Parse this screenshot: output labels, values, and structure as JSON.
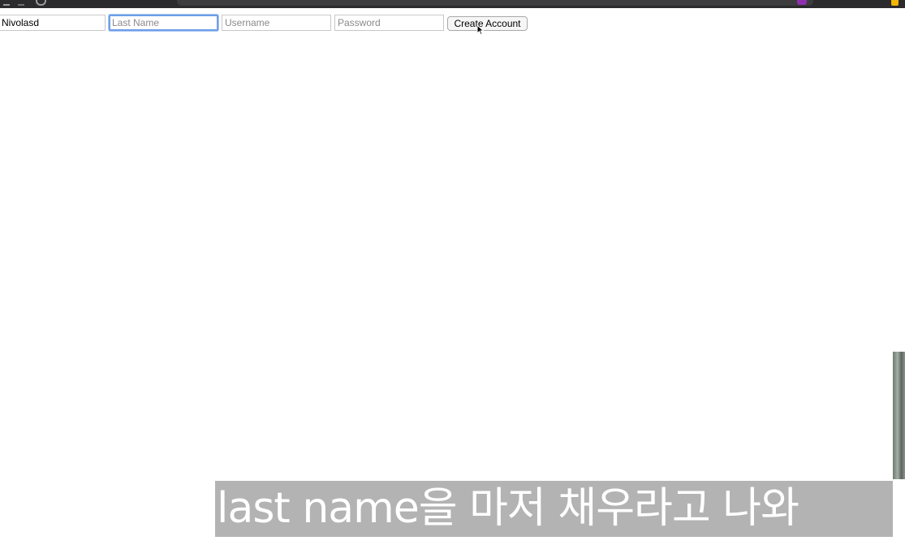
{
  "form": {
    "first_name": {
      "value": "Nivolasd",
      "placeholder": ""
    },
    "last_name": {
      "value": "",
      "placeholder": "Last Name"
    },
    "username": {
      "value": "",
      "placeholder": "Username"
    },
    "password": {
      "value": "",
      "placeholder": "Password"
    },
    "submit_label": "Create Account"
  },
  "caption": {
    "text": "last name을 마저 채우라고 나와"
  },
  "colors": {
    "focus_ring": "#6d9fe8",
    "caption_bg": "#b3b3b3",
    "caption_text": "#ffffff"
  }
}
